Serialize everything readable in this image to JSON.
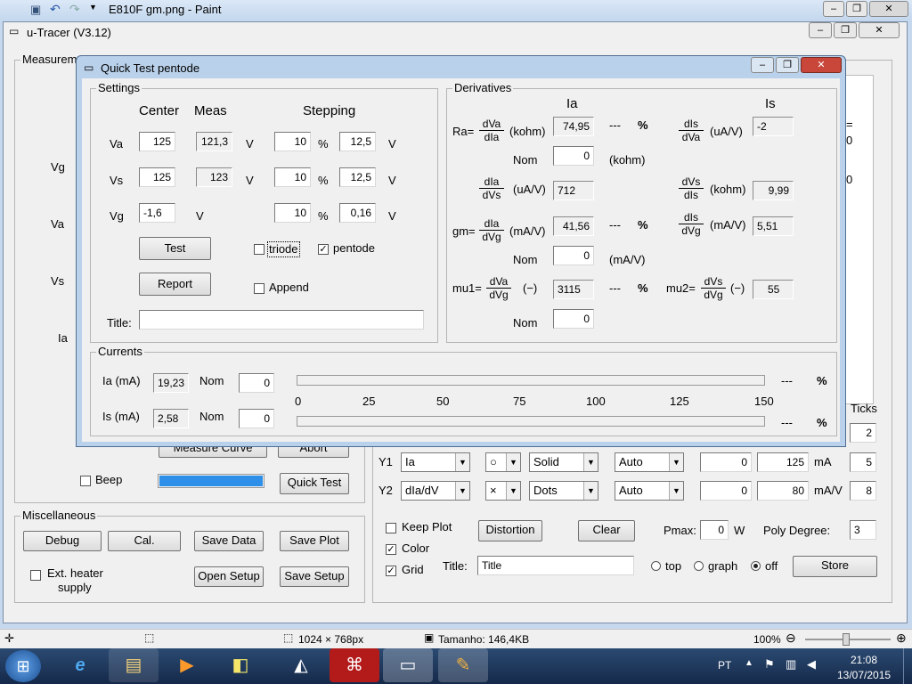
{
  "paint": {
    "title": "E810F gm.png - Paint",
    "status_size": "1024 × 768px",
    "status_filesize": "Tamanho: 146,4KB",
    "zoom": "100%"
  },
  "main": {
    "title": "u-Tracer (V3.12)",
    "measure_caption": "Measurem",
    "left_labels": {
      "vg": "Vg",
      "va": "Va",
      "vs": "Vs",
      "ia": "Ia"
    },
    "measure_curve": "Measure Curve",
    "abort": "Abort",
    "beep": "Beep",
    "quick_test": "Quick Test",
    "progress": 1.0,
    "misc": {
      "caption": "Miscellaneous",
      "debug": "Debug",
      "cal": "Cal.",
      "save_data": "Save Data",
      "save_plot": "Save Plot",
      "ext_heater": "Ext. heater",
      "supply": "supply",
      "open_setup": "Open Setup",
      "save_setup": "Save Setup"
    },
    "right_partial": {
      "eq": "=",
      "v0a": "0",
      "v0b": "0"
    },
    "graph": {
      "ticks_header": "Ticks",
      "tick0": "2",
      "y1": {
        "label": "Y1",
        "quantity": "Ia",
        "marker": "○",
        "line": "Solid",
        "scale": "Auto",
        "min": "0",
        "max": "125",
        "unit": "mA",
        "ticks": "5"
      },
      "y2": {
        "label": "Y2",
        "quantity": "dIa/dV",
        "marker": "×",
        "line": "Dots",
        "scale": "Auto",
        "min": "0",
        "max": "80",
        "unit": "mA/V",
        "ticks": "8"
      },
      "keep_plot": "Keep Plot",
      "distortion": "Distortion",
      "clear": "Clear",
      "pmax_label": "Pmax:",
      "pmax": "0",
      "pmax_unit": "W",
      "poly_label": "Poly Degree:",
      "poly": "3",
      "color": "Color",
      "grid": "Grid",
      "title_label": "Title:",
      "title_value": "Title",
      "top": "top",
      "graph": "graph",
      "off": "off",
      "store": "Store"
    }
  },
  "dialog": {
    "title": "Quick Test pentode",
    "settings": {
      "caption": "Settings",
      "center": "Center",
      "meas": "Meas",
      "stepping": "Stepping",
      "va": {
        "label": "Va",
        "center": "125",
        "meas": "121,3",
        "unit": "V",
        "step_pct": "10",
        "pct": "%",
        "step_v": "12,5",
        "unit2": "V"
      },
      "vs": {
        "label": "Vs",
        "center": "125",
        "meas": "123",
        "unit": "V",
        "step_pct": "10",
        "pct": "%",
        "step_v": "12,5",
        "unit2": "V"
      },
      "vg": {
        "label": "Vg",
        "center": "-1,6",
        "unit": "V",
        "step_pct": "10",
        "pct": "%",
        "step_v": "0,16",
        "unit2": "V"
      },
      "test": "Test",
      "report": "Report",
      "triode": "triode",
      "pentode": "pentode",
      "append": "Append",
      "title_label": "Title:",
      "title_value": ""
    },
    "deriv": {
      "caption": "Derivatives",
      "ia_header": "Ia",
      "is_header": "Is",
      "ra_label": "Ra=",
      "ra_num": "dVa",
      "ra_den": "dIa",
      "ra_unit": "(kohm)",
      "ra": "74,95",
      "ra_dev": "---",
      "ra_pct": "%",
      "nom": "Nom",
      "ra_nom": "0",
      "ra_nom_unit": "(kohm)",
      "is_va_num": "dIs",
      "is_va_den": "dVa",
      "is_va_unit": "(uA/V)",
      "is_va": "-2",
      "ia_vs_num": "dIa",
      "ia_vs_den": "dVs",
      "ia_vs_unit": "(uA/V)",
      "ia_vs": "712",
      "vs_is_num": "dVs",
      "vs_is_den": "dIs",
      "vs_is_unit": "(kohm)",
      "vs_is": "9,99",
      "gm_label": "gm=",
      "gm_num": "dIa",
      "gm_den": "dVg",
      "gm_unit": "(mA/V)",
      "gm": "41,56",
      "gm_dev": "---",
      "gm_pct": "%",
      "gm_nom": "0",
      "gm_nom_unit": "(mA/V)",
      "is_vg_num": "dIs",
      "is_vg_den": "dVg",
      "is_vg_unit": "(mA/V)",
      "is_vg": "5,51",
      "mu1_label": "mu1=",
      "mu1_num": "dVa",
      "mu1_den": "dVg",
      "mu1_unit": "(−)",
      "mu1": "3115",
      "mu1_dev": "---",
      "mu1_pct": "%",
      "mu2_label": "mu2=",
      "mu2_num": "dVs",
      "mu2_den": "dVg",
      "mu2_unit": "(−)",
      "mu2": "55",
      "mu1_nom": "0"
    },
    "currents": {
      "caption": "Currents",
      "ia_label": "Ia (mA)",
      "ia": "19,23",
      "nom": "Nom",
      "ia_nom": "0",
      "is_label": "Is (mA)",
      "is": "2,58",
      "is_nom": "0",
      "scale": [
        "0",
        "25",
        "50",
        "75",
        "100",
        "125",
        "150"
      ],
      "ia_dev": "---",
      "ia_pct": "%",
      "is_dev": "---",
      "is_pct": "%",
      "ia_fill": 0,
      "is_fill": 0
    }
  },
  "taskbar": {
    "lang": "PT",
    "time": "21:08",
    "date": "13/07/2015"
  }
}
